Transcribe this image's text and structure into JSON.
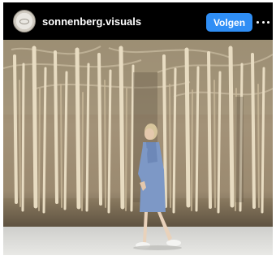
{
  "post": {
    "username": "sonnenberg.visuals",
    "follow_label": "Volgen",
    "more_icon": "more-horizontal-icon",
    "avatar_icon": "profile-avatar"
  },
  "colors": {
    "header_background": "#000000",
    "follow_button": "#2f8ef5",
    "text": "#ffffff"
  },
  "image": {
    "description_kind": "photo",
    "subject": "woman walking in front of a branch installation"
  }
}
